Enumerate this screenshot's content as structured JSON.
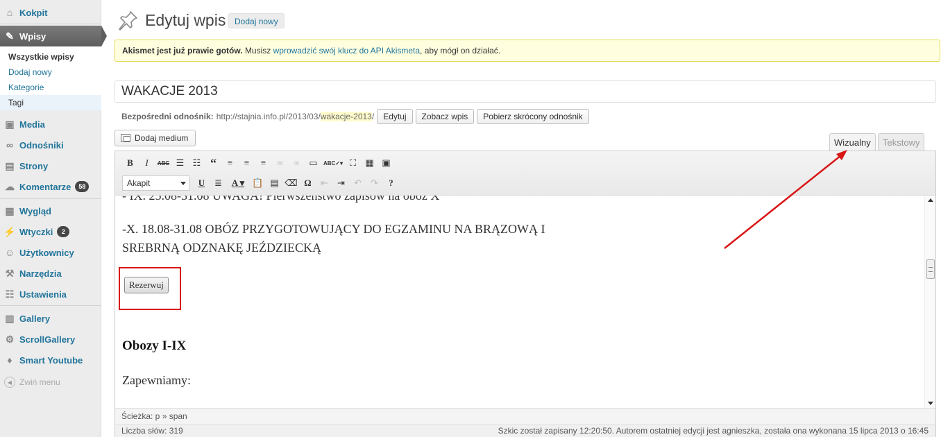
{
  "page": {
    "title": "Edytuj wpis",
    "add_new": "Dodaj nowy"
  },
  "sidebar": {
    "items": [
      {
        "label": "Kokpit",
        "icon": "home-icon"
      },
      {
        "label": "Wpisy",
        "icon": "pin-icon"
      },
      {
        "label": "Media",
        "icon": "media-icon"
      },
      {
        "label": "Odnośniki",
        "icon": "link-icon"
      },
      {
        "label": "Strony",
        "icon": "page-icon"
      },
      {
        "label": "Komentarze",
        "icon": "comment-icon",
        "badge": "58"
      },
      {
        "label": "Wygląd",
        "icon": "appearance-icon"
      },
      {
        "label": "Wtyczki",
        "icon": "plugin-icon",
        "badge": "2"
      },
      {
        "label": "Użytkownicy",
        "icon": "users-icon"
      },
      {
        "label": "Narzędzia",
        "icon": "tools-icon"
      },
      {
        "label": "Ustawienia",
        "icon": "settings-icon"
      },
      {
        "label": "Gallery",
        "icon": "gallery-icon"
      },
      {
        "label": "ScrollGallery",
        "icon": "gear-icon"
      },
      {
        "label": "Smart Youtube",
        "icon": "youtube-icon"
      }
    ],
    "submenu": [
      "Wszystkie wpisy",
      "Dodaj nowy",
      "Kategorie",
      "Tagi"
    ],
    "collapse": "Zwiń menu"
  },
  "notice": {
    "bold": "Akismet jest już prawie gotów.",
    "pre": "Musisz",
    "link": "wprowadzić swój klucz do API Akismeta",
    "post": ", aby mógł on działać."
  },
  "post": {
    "title": "WAKACJE 2013"
  },
  "permalink": {
    "label": "Bezpośredni odnośnik:",
    "base": "http://stajnia.info.pl/2013/03/",
    "slug": "wakacje-2013",
    "trail": "/",
    "edit": "Edytuj",
    "view": "Zobacz wpis",
    "shortlink": "Pobierz skrócony odnośnik"
  },
  "editor": {
    "add_media": "Dodaj medium",
    "tab_visual": "Wizualny",
    "tab_text": "Tekstowy",
    "format": "Akapit",
    "lines": [
      "- IX. 25.08-31.08 UWAGA! Pierwszeństwo zapisów na obóz X",
      "-X. 18.08-31.08 OBÓZ PRZYGOTOWUJĄCY DO EGZAMINU NA BRĄZOWĄ I",
      "SREBRNĄ ODZNAKĘ JEŹDZIECKĄ"
    ],
    "reserve_button": "Rezerwuj",
    "heading": "Obozy I-IX",
    "para": "Zapewniamy:",
    "path": "Ścieżka: p » span",
    "word_count": "Liczba słów: 319",
    "status": "Szkic został zapisany 12:20:50. Autorem ostatniej edycji jest agnieszka, została ona wykonana 15 lipca 2013 o 16:45"
  },
  "colors": {
    "link": "#21759b",
    "annotation": "#d91515",
    "notice_bg": "#ffffe0"
  }
}
